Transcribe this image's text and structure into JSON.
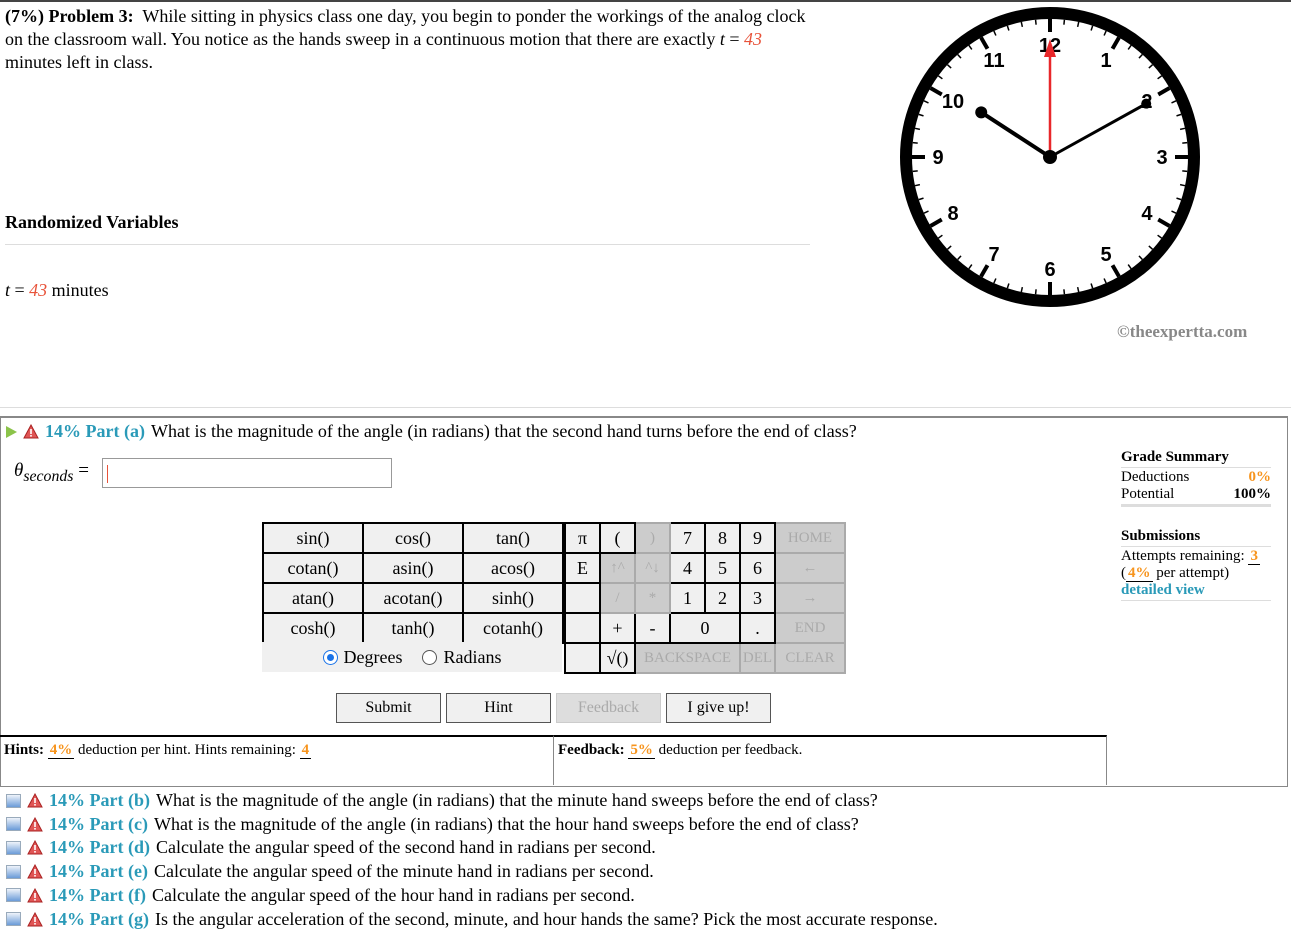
{
  "problem": {
    "weight": "(7%)",
    "title": "Problem 3:",
    "text1": "While sitting in physics class one day, you begin to ponder the workings of the analog clock on the classroom wall. You notice as the hands sweep in a continuous motion that there are exactly ",
    "var": "t",
    "eq": " = ",
    "value": "43",
    "text2": " minutes left in class."
  },
  "randomized": {
    "title": "Randomized Variables",
    "var": "t",
    "eq": " = ",
    "value": "43",
    "unit": " minutes"
  },
  "clock": {
    "numbers": [
      "12",
      "1",
      "2",
      "3",
      "4",
      "5",
      "6",
      "7",
      "8",
      "9",
      "10",
      "11"
    ],
    "second_color": "#e8272a"
  },
  "copyright": "©theexpertta.com",
  "part_a": {
    "label": "14% Part (a)",
    "question": "What is the magnitude of the angle (in radians) that the second hand turns before the end of class?",
    "symbol": "θ",
    "subscript": "seconds",
    "eq": " =",
    "input_value": ""
  },
  "keypad": {
    "functions": [
      [
        "sin()",
        "cos()",
        "tan()"
      ],
      [
        "cotan()",
        "asin()",
        "acos()"
      ],
      [
        "atan()",
        "acotan()",
        "sinh()"
      ],
      [
        "cosh()",
        "tanh()",
        "cotanh()"
      ]
    ],
    "rows": [
      [
        "π",
        "(",
        ")",
        "7",
        "8",
        "9",
        "HOME"
      ],
      [
        "E",
        "↑^",
        "^↓",
        "4",
        "5",
        "6",
        "←"
      ],
      [
        "",
        "/",
        "*",
        "1",
        "2",
        "3",
        "→"
      ],
      [
        "",
        "+",
        "-",
        "0",
        ".",
        "END"
      ],
      [
        "",
        "√()",
        "BACKSPACE",
        "DEL",
        "CLEAR"
      ]
    ],
    "degrees": "Degrees",
    "radians": "Radians",
    "mode": "Degrees"
  },
  "buttons": {
    "submit": "Submit",
    "hint": "Hint",
    "feedback": "Feedback",
    "give_up": "I give up!"
  },
  "hints": {
    "label": "Hints:",
    "pct": "4%",
    "text": " deduction per hint. Hints remaining: ",
    "remaining": "4"
  },
  "feedback": {
    "label": "Feedback:",
    "pct": "5%",
    "text": " deduction per feedback."
  },
  "grade": {
    "title": "Grade Summary",
    "deductions_label": "Deductions",
    "deductions": "0%",
    "potential_label": "Potential",
    "potential": "100%",
    "submissions_title": "Submissions",
    "attempts_label": "Attempts remaining: ",
    "attempts": "3",
    "per_attempt_pct": "4%",
    "per_attempt_text": " per attempt)",
    "detailed": "detailed view"
  },
  "parts": [
    {
      "label": "14% Part (b)",
      "question": "What is the magnitude of the angle (in radians) that the minute hand sweeps before the end of class?"
    },
    {
      "label": "14% Part (c)",
      "question": "What is the magnitude of the angle (in radians) that the hour hand sweeps before the end of class?"
    },
    {
      "label": "14% Part (d)",
      "question": "Calculate the angular speed of the second hand in radians per second."
    },
    {
      "label": "14% Part (e)",
      "question": "Calculate the angular speed of the minute hand in radians per second."
    },
    {
      "label": "14% Part (f)",
      "question": "Calculate the angular speed of the hour hand in radians per second."
    },
    {
      "label": "14% Part (g)",
      "question": "Is the angular acceleration of the second, minute, and hour hands the same? Pick the most accurate response."
    }
  ]
}
